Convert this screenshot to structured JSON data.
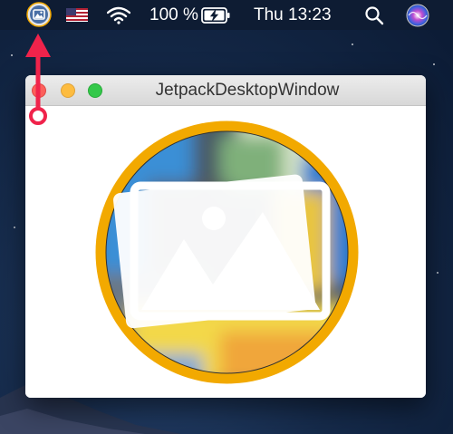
{
  "menubar": {
    "battery_percent": "100 %",
    "clock": "Thu 13:23"
  },
  "window": {
    "title": "JetpackDesktopWindow"
  },
  "colors": {
    "menubar_bg": "#0e1c33",
    "logo_ring": "#f2a900",
    "close": "#fc605c",
    "minimize": "#fdbc40",
    "zoom": "#34c84a",
    "annotation": "#f0234b"
  },
  "icons": {
    "status_item": "app-status-icon",
    "flag": "flag-icon",
    "wifi": "wifi-icon",
    "battery": "battery-charging-icon",
    "search": "search-icon",
    "siri": "siri-icon",
    "logo": "image-gallery-icon"
  }
}
